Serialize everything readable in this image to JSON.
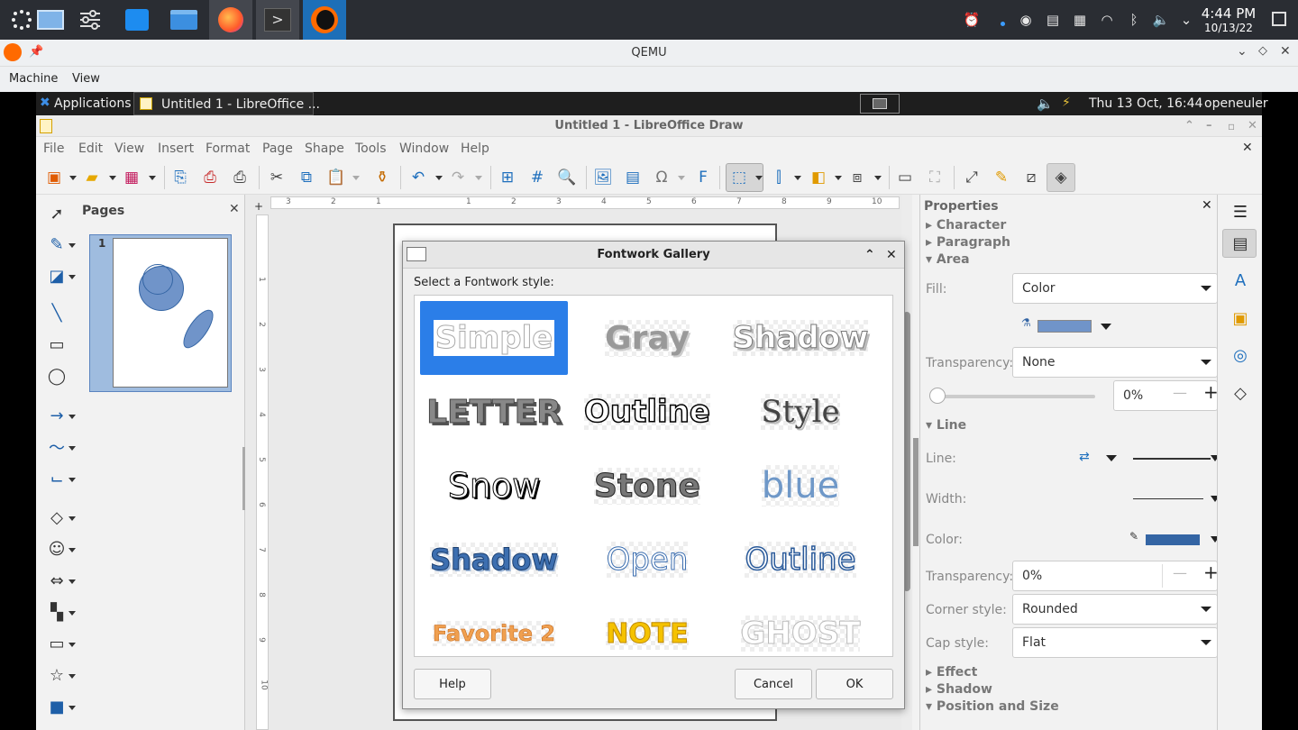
{
  "host": {
    "clock_time": "4:44 PM",
    "clock_date": "10/13/22"
  },
  "qemu": {
    "title": "QEMU",
    "menu": [
      "Machine",
      "View"
    ]
  },
  "guest_panel": {
    "applications": "Applications",
    "task": "Untitled 1 - LibreOffice ...",
    "datetime": "Thu 13 Oct, 16:44",
    "user": "openeuler"
  },
  "lo": {
    "title": "Untitled 1 - LibreOffice Draw",
    "menu": [
      "File",
      "Edit",
      "View",
      "Insert",
      "Format",
      "Page",
      "Shape",
      "Tools",
      "Window",
      "Help"
    ],
    "pages_title": "Pages",
    "page_number": "1",
    "ruler_h": [
      "3",
      "2",
      "1",
      "1",
      "2",
      "3",
      "4",
      "5",
      "6",
      "7",
      "8",
      "9",
      "10"
    ],
    "ruler_v": [
      "1",
      "2",
      "3",
      "4",
      "5",
      "6",
      "7",
      "8",
      "9",
      "10"
    ]
  },
  "properties": {
    "title": "Properties",
    "character": "Character",
    "paragraph": "Paragraph",
    "area": "Area",
    "fill_label": "Fill:",
    "fill_value": "Color",
    "transparency_label": "Transparency:",
    "transparency_value": "None",
    "transparency_pct": "0%",
    "line_section": "Line",
    "line_label": "Line:",
    "width_label": "Width:",
    "color_label": "Color:",
    "line_transparency_label": "Transparency:",
    "line_transparency_value": "0%",
    "corner_label": "Corner style:",
    "corner_value": "Rounded",
    "cap_label": "Cap style:",
    "cap_value": "Flat",
    "effect": "Effect",
    "shadow": "Shadow",
    "position_size": "Position and Size",
    "fill_color": "#7094c9",
    "line_color": "#3465a4"
  },
  "dialog": {
    "title": "Fontwork Gallery",
    "prompt": "Select a Fontwork style:",
    "styles": [
      "Simple",
      "Gray",
      "Shadow",
      "LETTER",
      "Outline",
      "Style",
      "Snow",
      "Stone",
      "blue",
      "Shadow",
      "Open",
      "Outline",
      "Favorite 2",
      "NOTE",
      "GHOST"
    ],
    "help": "Help",
    "cancel": "Cancel",
    "ok": "OK"
  }
}
